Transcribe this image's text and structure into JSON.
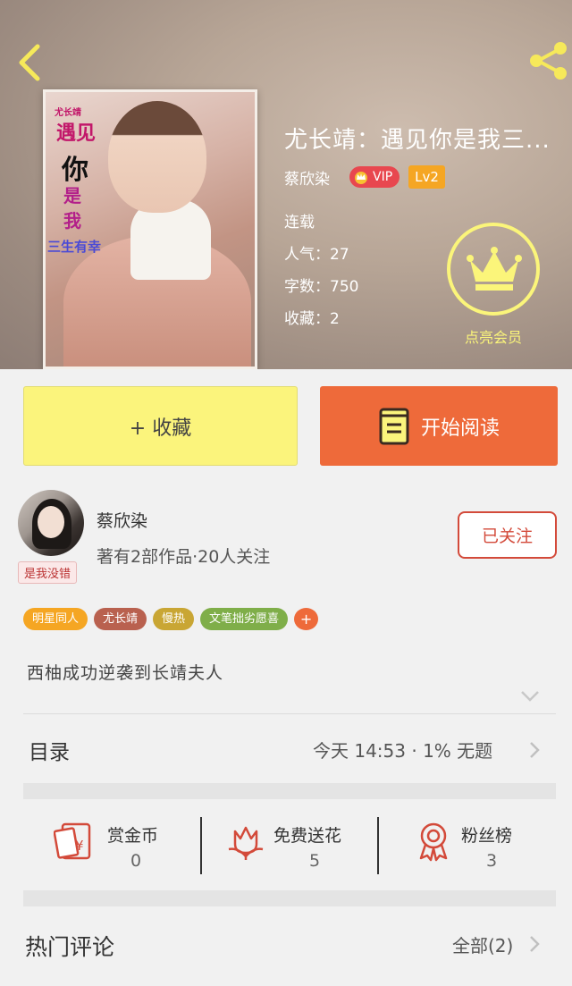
{
  "book": {
    "title": "尤长靖：遇见你是我三...",
    "author": "蔡欣染",
    "vip_label": "VIP",
    "level": "Lv2",
    "status": "连载",
    "popularity": "人气：27",
    "word_count": "字数：750",
    "favorites": "收藏：2",
    "cover": {
      "line1": "尤长靖",
      "line2": "遇见",
      "line3": "你",
      "line4": "是",
      "line5": "我",
      "line6": "三生有幸"
    }
  },
  "member": {
    "label": "点亮会员"
  },
  "actions": {
    "collect_label": "+ 收藏",
    "read_label": "开始阅读"
  },
  "creator": {
    "name": "蔡欣染",
    "stats": "著有2部作品·20人关注",
    "avatar_tag": "是我没错",
    "follow_label": "已关注"
  },
  "tags": [
    {
      "label": "明星同人",
      "color": "#f5a623"
    },
    {
      "label": "尤长靖",
      "color": "#b9614f"
    },
    {
      "label": "慢热",
      "color": "#c9a634"
    },
    {
      "label": "文笔拙劣愿喜",
      "color": "#7fae49"
    }
  ],
  "tag_add": "+",
  "intro": "西柚成功逆袭到长靖夫人",
  "toc": {
    "label": "目录",
    "info": "今天 14:53 · 1%  无题"
  },
  "stats": [
    {
      "label": "赏金币",
      "value": "0"
    },
    {
      "label": "免费送花",
      "value": "5"
    },
    {
      "label": "粉丝榜",
      "value": "3"
    }
  ],
  "comments": {
    "label": "热门评论",
    "all_label": "全部(2)"
  },
  "colors": {
    "accent_orange": "#ee6a3a",
    "collect_yellow": "#fbf47c",
    "icon_red": "#d34a3a",
    "member_yellow": "#fbf57a"
  },
  "icons": [
    "back-arrow-icon",
    "share-icon",
    "crown-icon",
    "book-icon",
    "red-envelope-icon",
    "flower-icon",
    "medal-icon",
    "chevron-down-icon",
    "chevron-right-icon"
  ]
}
